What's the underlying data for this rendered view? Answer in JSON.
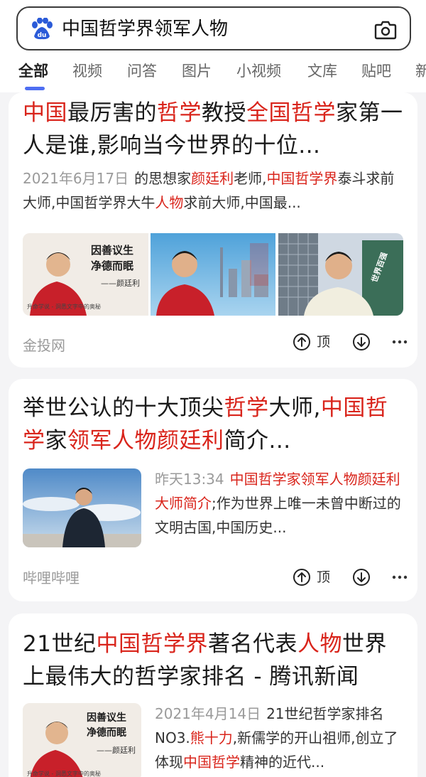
{
  "search": {
    "query": "中国哲学界领军人物"
  },
  "tabs": [
    {
      "label": "全部",
      "active": true
    },
    {
      "label": "视频"
    },
    {
      "label": "问答"
    },
    {
      "label": "图片"
    },
    {
      "label": "小视频"
    },
    {
      "label": "文库"
    },
    {
      "label": "贴吧"
    },
    {
      "label": "新"
    }
  ],
  "results": [
    {
      "title_parts": [
        {
          "t": "中国",
          "hl": true
        },
        {
          "t": "最厉害的"
        },
        {
          "t": "哲学",
          "hl": true
        },
        {
          "t": "教授"
        },
        {
          "t": "全国哲学",
          "hl": true
        },
        {
          "t": "家第一人是谁,影响当今世界的十位..."
        }
      ],
      "date": "2021年6月17日",
      "snippet_parts": [
        {
          "t": "的思想家"
        },
        {
          "t": "颜廷利",
          "hl": true
        },
        {
          "t": "老师,"
        },
        {
          "t": "中国哲学界",
          "hl": true
        },
        {
          "t": "泰斗求前大师,中国哲学界大牛"
        },
        {
          "t": "人物",
          "hl": true
        },
        {
          "t": "求前大师,中国最..."
        }
      ],
      "images": [
        {
          "caption_vertical_1": "因善议生",
          "caption_vertical_2": "净德而眠",
          "signature": "——颜廷利",
          "small_text": "升命学说 - 洞悉文字中的奥秘"
        },
        {
          "small_text": ""
        },
        {
          "small_text": "世界百强"
        }
      ],
      "source": "金投网",
      "up_label": "顶"
    },
    {
      "title_parts": [
        {
          "t": "举世公认的十大顶尖"
        },
        {
          "t": "哲学",
          "hl": true
        },
        {
          "t": "大师,"
        },
        {
          "t": "中国哲学",
          "hl": true
        },
        {
          "t": "家"
        },
        {
          "t": "领军人物颜廷利",
          "hl": true
        },
        {
          "t": "简介..."
        }
      ],
      "date": "昨天13:34",
      "snippet_parts": [
        {
          "t": "中国哲学家领军人物颜廷利大师简介",
          "hl": true
        },
        {
          "t": ";作为世界上唯一未曾中断过的文明古国,中国历史..."
        }
      ],
      "source": "哔哩哔哩",
      "up_label": "顶"
    },
    {
      "title_parts": [
        {
          "t": "21世纪"
        },
        {
          "t": "中国哲学界",
          "hl": true
        },
        {
          "t": "著名代表"
        },
        {
          "t": "人物",
          "hl": true
        },
        {
          "t": "世界上最伟大的哲学家排名 - 腾讯新闻"
        }
      ],
      "date": "2021年4月14日",
      "snippet_parts": [
        {
          "t": "21世纪哲学家排名NO3."
        },
        {
          "t": "熊十力",
          "hl": true
        },
        {
          "t": ",新儒学的开山祖师,创立了体现"
        },
        {
          "t": "中国哲学",
          "hl": true
        },
        {
          "t": "精神的近代..."
        }
      ],
      "image": {
        "caption_vertical_1": "因善议生",
        "caption_vertical_2": "净德而眠",
        "signature": "——颜廷利",
        "small_text": "升命学说 - 洞悉文字中的奥秘"
      }
    }
  ],
  "colors": {
    "highlight": "#d9241b",
    "accent": "#4e6ef2",
    "muted": "#9a9a9a"
  },
  "icons": {
    "logo": "baidu-paw-icon",
    "camera": "camera-icon",
    "up": "thumb-up-arrow-icon",
    "down": "down-arrow-icon",
    "more": "more-dots-icon"
  }
}
